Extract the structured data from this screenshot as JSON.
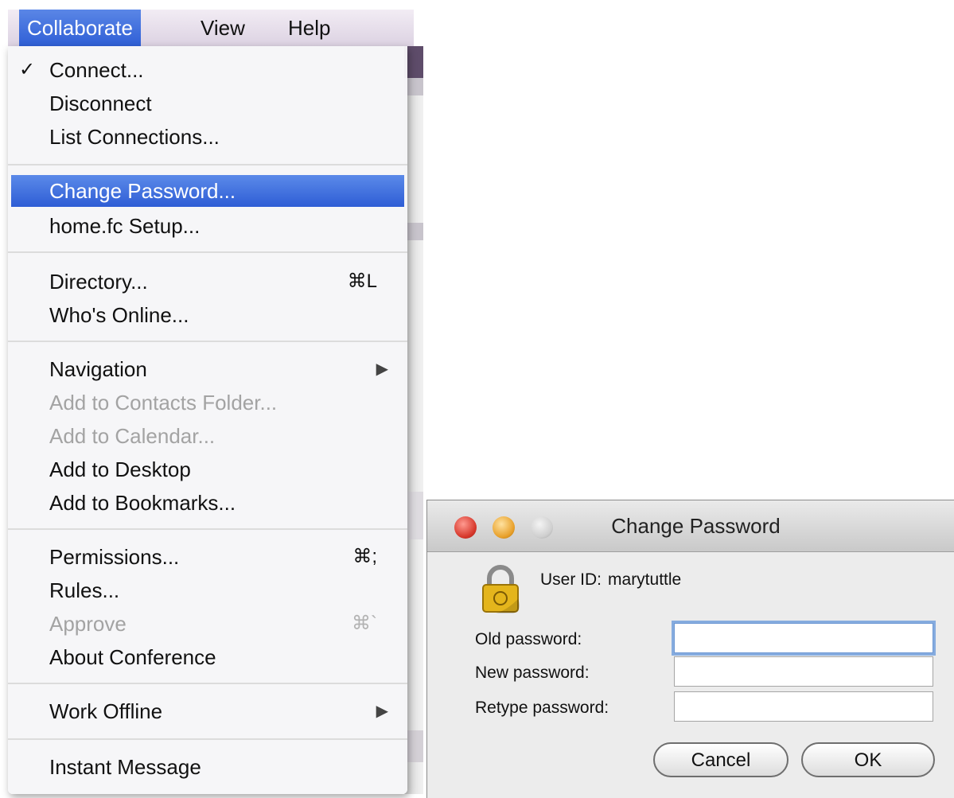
{
  "menubar": {
    "items": [
      "Collaborate",
      "View",
      "Help"
    ],
    "active": "Collaborate"
  },
  "menu": {
    "check_mark": "✓",
    "items": [
      {
        "label": "Connect...",
        "checked": true
      },
      {
        "label": "Disconnect"
      },
      {
        "label": "List Connections..."
      },
      {
        "label": "Change Password...",
        "highlighted": true
      },
      {
        "label": "home.fc Setup..."
      },
      {
        "label": "Directory...",
        "shortcut": "⌘L"
      },
      {
        "label": "Who's Online..."
      },
      {
        "label": "Navigation",
        "submenu": true
      },
      {
        "label": "Add to Contacts Folder...",
        "disabled": true
      },
      {
        "label": "Add to Calendar...",
        "disabled": true
      },
      {
        "label": "Add to Desktop"
      },
      {
        "label": "Add to Bookmarks..."
      },
      {
        "label": "Permissions...",
        "shortcut": "⌘;"
      },
      {
        "label": "Rules..."
      },
      {
        "label": "Approve",
        "shortcut": "⌘`",
        "disabled": true
      },
      {
        "label": "About Conference"
      },
      {
        "label": "Work Offline",
        "submenu": true
      },
      {
        "label": "Instant Message"
      }
    ],
    "submenu_arrow": "▶"
  },
  "dialog": {
    "title": "Change Password",
    "user_id_label": "User ID:",
    "user_id_value": "marytuttle",
    "fields": [
      {
        "label": "Old password:",
        "value": "",
        "focused": true
      },
      {
        "label": "New password:",
        "value": ""
      },
      {
        "label": "Retype password:",
        "value": ""
      }
    ],
    "cancel_label": "Cancel",
    "ok_label": "OK",
    "icons": [
      "close-button",
      "minimize-button",
      "zoom-button",
      "lock-icon"
    ]
  },
  "colors": {
    "highlight": "#2e5dd5",
    "focus_ring": "#86acdf"
  }
}
